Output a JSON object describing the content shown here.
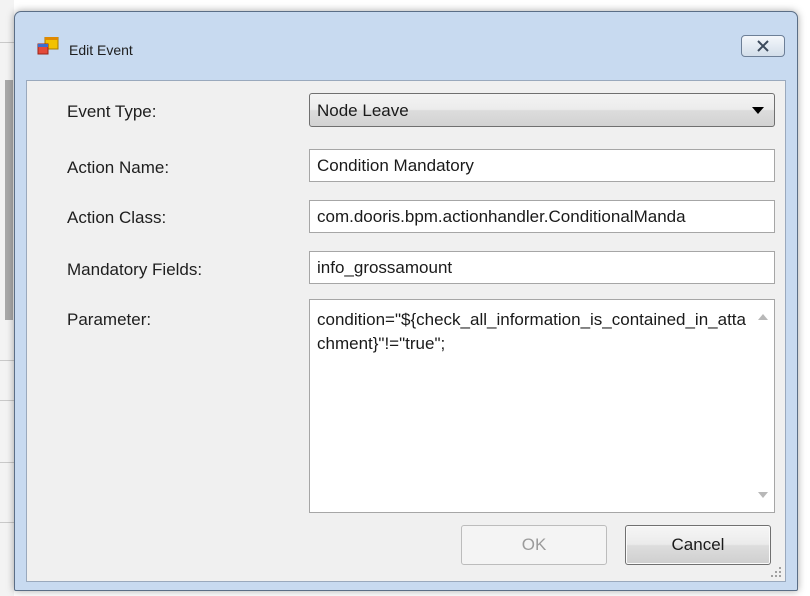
{
  "window": {
    "title": "Edit Event",
    "icon": "app-window-icon",
    "close_icon": "close-icon"
  },
  "form": {
    "event_type": {
      "label": "Event Type:",
      "value": "Node Leave"
    },
    "action_name": {
      "label": "Action Name:",
      "value": "Condition Mandatory"
    },
    "action_class": {
      "label": "Action Class:",
      "value": "com.dooris.bpm.actionhandler.ConditionalManda"
    },
    "mandatory_fields": {
      "label": "Mandatory Fields:",
      "value": "info_grossamount"
    },
    "parameter": {
      "label": "Parameter:",
      "value": "condition=\"${check_all_information_is_contained_in_attachment}\"!=\"true\";"
    }
  },
  "buttons": {
    "ok": "OK",
    "cancel": "Cancel"
  },
  "colors": {
    "titlebar": "#c8daf0",
    "client": "#f0f0f0",
    "disabled_text": "#9b9b9b"
  }
}
